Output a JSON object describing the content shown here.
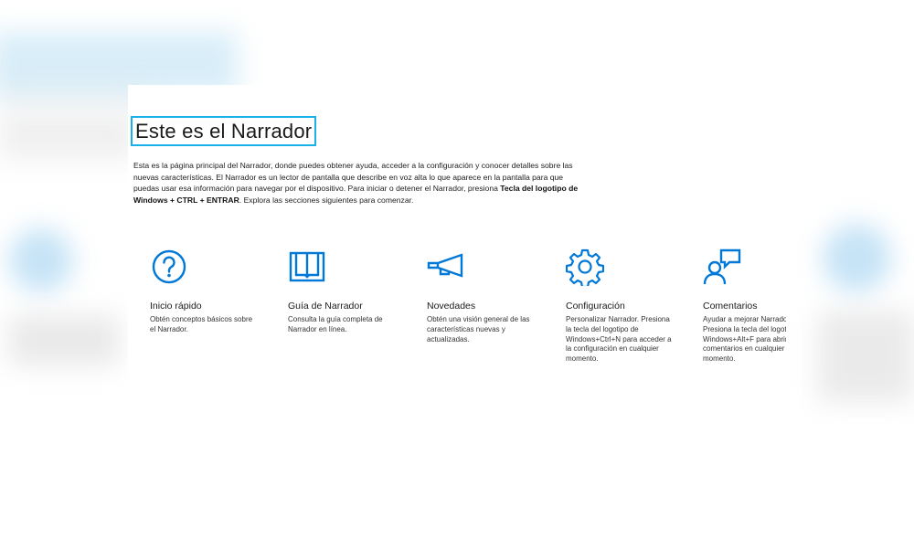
{
  "page": {
    "title": "Este es el Narrador",
    "intro_text": "Esta es la página principal del Narrador, donde puedes obtener ayuda, acceder a la configuración y conocer detalles sobre las nuevas características. El Narrador es un lector de pantalla que describe en voz alta lo que aparece en la pantalla para que puedas usar esa información para navegar por el dispositivo. Para iniciar o detener el Narrador, presiona ",
    "intro_shortcut": "Tecla del logotipo de Windows + CTRL + ENTRAR",
    "intro_end": ". Explora las secciones siguientes para comenzar."
  },
  "cards": [
    {
      "title": "Inicio rápido",
      "description": "Obtén conceptos básicos sobre el Narrador.",
      "icon": "question-circle-icon"
    },
    {
      "title": "Guía de Narrador",
      "description": "Consulta la guía completa de Narrador en línea.",
      "icon": "book-icon"
    },
    {
      "title": "Novedades",
      "description": "Obtén una visión general de las características nuevas y actualizadas.",
      "icon": "megaphone-icon"
    },
    {
      "title": "Configuración",
      "description": "Personalizar Narrador. Presiona la tecla del logotipo de Windows+Ctrl+N para acceder a la configuración en cualquier momento.",
      "icon": "gear-icon"
    },
    {
      "title": "Comentarios",
      "description": "Ayudar a mejorar Narrador. Presiona la tecla del logotipo de Windows+Alt+F para abrir comentarios en cualquier momento.",
      "icon": "feedback-icon"
    }
  ],
  "colors": {
    "accent": "#0078d7",
    "focus_border": "#1ab0e8"
  }
}
